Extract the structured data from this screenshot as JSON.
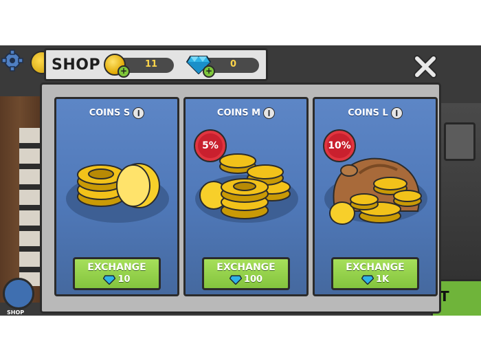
{
  "header": {
    "title": "SHOP"
  },
  "currency": {
    "coins": {
      "icon": "coin-icon",
      "value": "11"
    },
    "gems": {
      "icon": "gem-icon",
      "value": "0"
    }
  },
  "background": {
    "corner_label": "SHOP",
    "right_button_text": "T"
  },
  "cards": [
    {
      "title": "COINS S",
      "badge": "",
      "exchange_label": "EXCHANGE",
      "price": "10"
    },
    {
      "title": "COINS M",
      "badge": "5%",
      "exchange_label": "EXCHANGE",
      "price": "100"
    },
    {
      "title": "COINS L",
      "badge": "10%",
      "exchange_label": "EXCHANGE",
      "price": "1K"
    }
  ],
  "colors": {
    "card_blue": "#4f78b8",
    "exchange_green": "#8ed04a",
    "badge_red": "#c9202e",
    "coin_gold": "#f2c21a"
  }
}
